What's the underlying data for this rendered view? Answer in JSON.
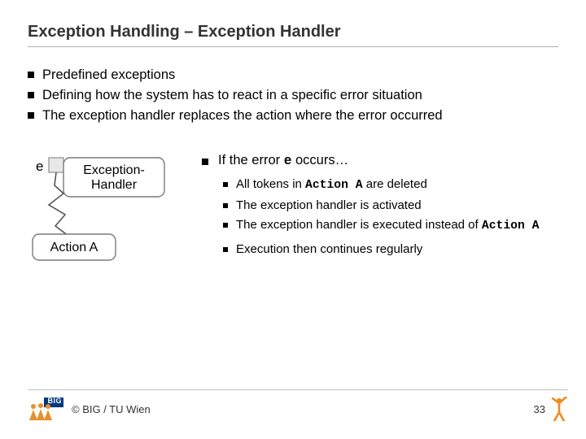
{
  "title": "Exception Handling – Exception Handler",
  "top_bullets": [
    "Predefined exceptions",
    "Defining how the system has to react in a specific error situation",
    "The exception handler replaces the action where the error occurred"
  ],
  "diagram": {
    "event_label": "e",
    "handler_line1": "Exception-",
    "handler_line2": "Handler",
    "action_label": "Action A"
  },
  "right": {
    "main_prefix": "If the error ",
    "main_code": "e",
    "main_suffix": " occurs…",
    "subs": [
      {
        "pre": "All tokens in ",
        "code": "Action A",
        "post": " are deleted"
      },
      {
        "pre": "The exception handler is activated",
        "code": "",
        "post": ""
      },
      {
        "pre": "The exception handler is executed instead of ",
        "code": "Action A",
        "post": ""
      },
      {
        "pre": "Execution then continues regularly",
        "code": "",
        "post": ""
      }
    ]
  },
  "footer": {
    "logo_text": "BIG",
    "org": "© BIG / TU Wien",
    "page": "33"
  }
}
